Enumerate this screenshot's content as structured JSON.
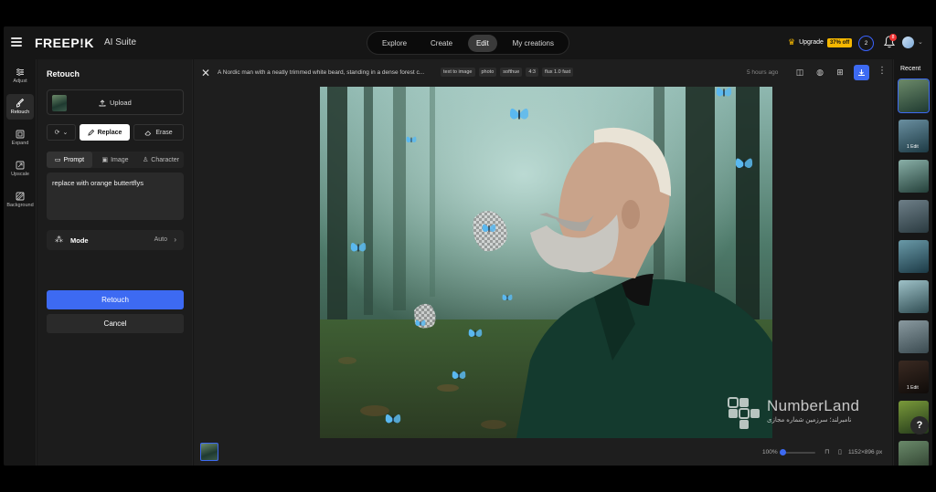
{
  "header": {
    "logo": "FREEP!K",
    "suite": "AI Suite",
    "nav": [
      {
        "label": "Explore"
      },
      {
        "label": "Create"
      },
      {
        "label": "Edit"
      },
      {
        "label": "My creations"
      }
    ],
    "active_nav": "Edit",
    "upgrade_label": "Upgrade",
    "upgrade_badge": "37% off",
    "credits": "2",
    "notifications": "8"
  },
  "rail": [
    {
      "label": "Adjust",
      "icon": "sliders-icon"
    },
    {
      "label": "Retouch",
      "icon": "brush-icon"
    },
    {
      "label": "Expand",
      "icon": "expand-icon"
    },
    {
      "label": "Upscale",
      "icon": "upscale-icon"
    },
    {
      "label": "Background",
      "icon": "background-icon"
    }
  ],
  "panel": {
    "title": "Retouch",
    "upload_label": "Upload",
    "replace_label": "Replace",
    "erase_label": "Erase",
    "tabs": [
      {
        "label": "Prompt"
      },
      {
        "label": "Image"
      },
      {
        "label": "Character"
      }
    ],
    "prompt_value": "replace with orange buttertflys",
    "mode_label": "Mode",
    "mode_value": "Auto",
    "retouch_label": "Retouch",
    "cancel_label": "Cancel"
  },
  "canvas": {
    "prompt_text": "A Nordic man with a neatly trimmed white beard, standing in a dense forest c...",
    "chips": [
      "text to image",
      "photo",
      "softhue",
      "4:3",
      "flux 1.0 fast"
    ],
    "time": "5 hours ago",
    "zoom": "100%",
    "zoom_fraction": 0.0,
    "dimensions": "1152×896 px"
  },
  "recent": {
    "title": "Recent",
    "items": [
      {
        "edit": ""
      },
      {
        "edit": "1 Edit"
      },
      {
        "edit": ""
      },
      {
        "edit": ""
      },
      {
        "edit": ""
      },
      {
        "edit": ""
      },
      {
        "edit": ""
      },
      {
        "edit": "1 Edit"
      },
      {
        "edit": ""
      },
      {
        "edit": ""
      }
    ]
  },
  "watermark": {
    "title": "NumberLand",
    "subtitle": "نامبرلند؛ سرزمین شماره مجازی"
  },
  "colors": {
    "accent": "#3d6af2",
    "upgrade": "#f5b700",
    "butterfly": "#5ab8f0"
  }
}
